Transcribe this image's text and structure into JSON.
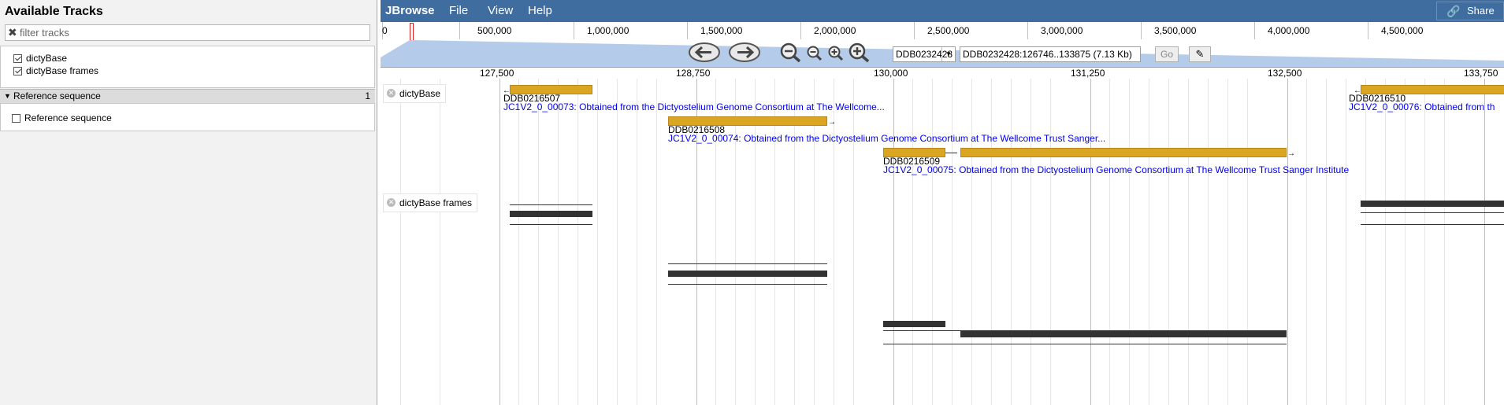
{
  "left_pane": {
    "title": "Available Tracks",
    "filter": {
      "clear_glyph": "✖",
      "placeholder": "filter tracks"
    },
    "tracks": [
      {
        "label": "dictyBase",
        "checked": true
      },
      {
        "label": "dictyBase frames",
        "checked": true
      }
    ],
    "category": {
      "name": "Reference sequence",
      "count": "1",
      "expanded": true
    },
    "category_tracks": [
      {
        "label": "Reference sequence",
        "checked": false
      }
    ]
  },
  "menubar": {
    "brand": "JBrowse",
    "menus": [
      "File",
      "View",
      "Help"
    ],
    "share_label": "Share",
    "share_icon": "link-icon",
    "color": "#3f6da0"
  },
  "overview": {
    "ticks": [
      "0",
      "500,000",
      "1,000,000",
      "1,500,000",
      "2,000,000",
      "2,500,000",
      "3,000,000",
      "3,500,000",
      "4,000,000",
      "4,500,000"
    ]
  },
  "navigation": {
    "buttons": [
      "pan-left-icon",
      "pan-right-icon",
      "zoom-out-big-icon",
      "zoom-out-icon",
      "zoom-in-icon",
      "zoom-in-big-icon"
    ],
    "refseq": "DDB0232428",
    "location": "DDB0232428:126746..133875 (7.13 Kb)",
    "go_label": "Go",
    "highlight_icon": "highlighter-icon"
  },
  "scale": {
    "ticks": [
      "127,500",
      "128,750",
      "130,000",
      "131,250",
      "132,500",
      "133,750"
    ]
  },
  "tracks": [
    {
      "label": "dictyBase",
      "features": [
        {
          "name": "DDB0216507",
          "description": "JC1V2_0_00073: Obtained from the Dictyostelium Genome Consortium at The Wellcome..."
        },
        {
          "name": "DDB0216508",
          "description": "JC1V2_0_00074: Obtained from the Dictyostelium Genome Consortium at The Wellcome Trust Sanger..."
        },
        {
          "name": "DDB0216509",
          "description": "JC1V2_0_00075: Obtained from the Dictyostelium Genome Consortium at The Wellcome Trust Sanger Institute"
        },
        {
          "name": "DDB0216510",
          "description": "JC1V2_0_00076: Obtained from th"
        }
      ],
      "feature_color": "#daa520"
    },
    {
      "label": "dictyBase frames"
    }
  ]
}
